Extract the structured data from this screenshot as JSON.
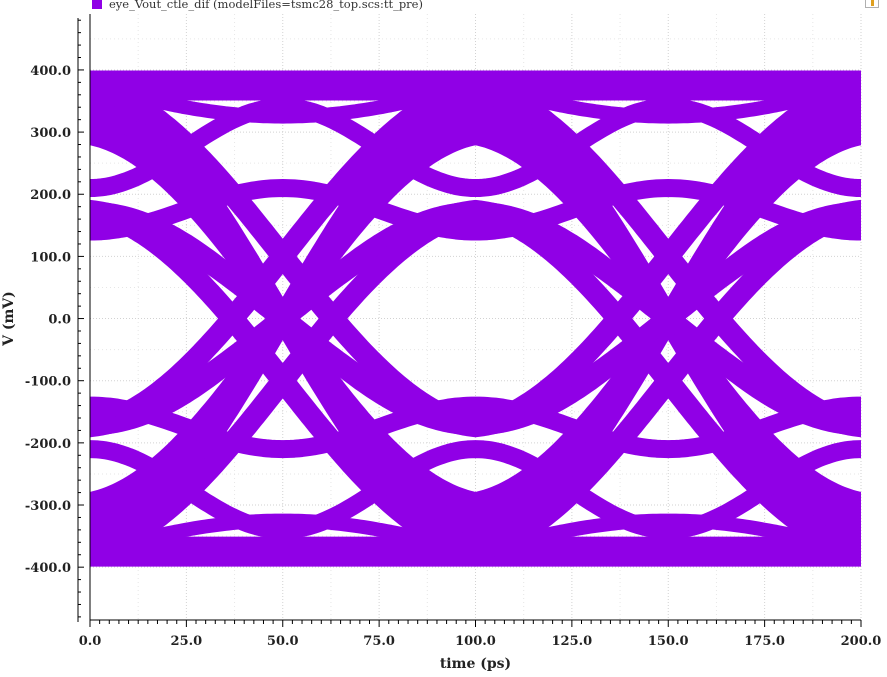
{
  "legend": {
    "label": "eye_Vout_ctle_dif (modelFiles=tsmc28_top.scs:tt_pre)",
    "color": "#9000e6"
  },
  "chart_data": {
    "type": "line",
    "description_kind": "eye-diagram",
    "xlabel": "time (ps)",
    "ylabel": "V (mV)",
    "xlim": [
      0,
      200
    ],
    "ylim": [
      -485,
      490
    ],
    "x_ticks": [
      0,
      25,
      50,
      75,
      100,
      125,
      150,
      175,
      200
    ],
    "x_tick_labels": [
      "0.0",
      "25.0",
      "50.0",
      "75.0",
      "100.0",
      "125.0",
      "150.0",
      "175.0",
      "200.0"
    ],
    "y_ticks": [
      400,
      300,
      200,
      100,
      0,
      -100,
      -200,
      -300,
      -400
    ],
    "y_tick_labels": [
      "400.0",
      "300.0",
      "200.0",
      "100.0",
      "0.0",
      "-100.0",
      "-200.0",
      "-300.0",
      "-400.0"
    ],
    "grid": true,
    "series_color": "#9000e6",
    "series": [
      {
        "name": "eye_Vout_ctle_dif (modelFiles=tsmc28_top.scs:tt_pre)",
        "unit_interval_ps": 100,
        "crossing_times_ps": [
          50,
          150
        ],
        "levels_mV": [
          -400,
          -350,
          -200,
          -140,
          140,
          200,
          350,
          400
        ]
      }
    ]
  }
}
